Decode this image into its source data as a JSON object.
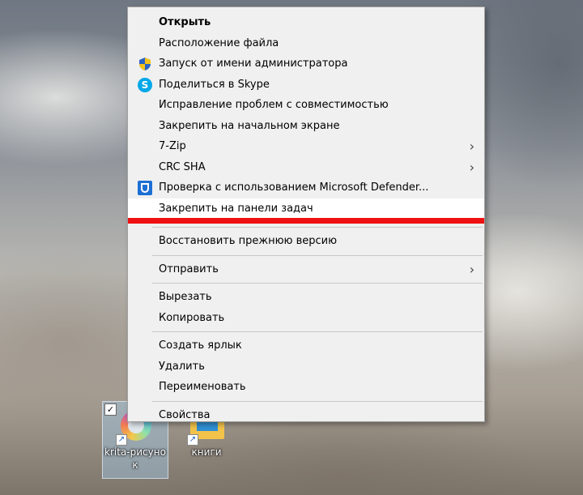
{
  "context_menu": {
    "items": [
      {
        "label": "Открыть"
      },
      {
        "label": "Расположение файла"
      },
      {
        "label": "Запуск от имени администратора",
        "icon": "uac-shield-icon"
      },
      {
        "label": "Поделиться в Skype",
        "icon": "skype-icon"
      },
      {
        "label": "Исправление проблем с совместимостью"
      },
      {
        "label": "Закрепить на начальном экране"
      },
      {
        "label": "7-Zip"
      },
      {
        "label": "CRC SHA"
      },
      {
        "label": "Проверка с использованием Microsoft Defender...",
        "icon": "defender-icon"
      },
      {
        "label": "Закрепить на панели задач"
      },
      {
        "label": "Восстановить прежнюю версию"
      },
      {
        "label": "Отправить"
      },
      {
        "label": "Вырезать"
      },
      {
        "label": "Копировать"
      },
      {
        "label": "Создать ярлык"
      },
      {
        "label": "Удалить"
      },
      {
        "label": "Переименовать"
      },
      {
        "label": "Свойства"
      }
    ],
    "submenu_glyph": "›",
    "skype_glyph": "S",
    "highlight_color": "#ffffff",
    "annotation_color": "#ee1111"
  },
  "desktop": {
    "icons": [
      {
        "label": "krita-рисунок",
        "icon": "krita-icon",
        "selected": true
      },
      {
        "label": "книги",
        "icon": "folder-icon",
        "selected": false
      }
    ],
    "shortcut_glyph": "↗",
    "check_glyph": "✓"
  }
}
